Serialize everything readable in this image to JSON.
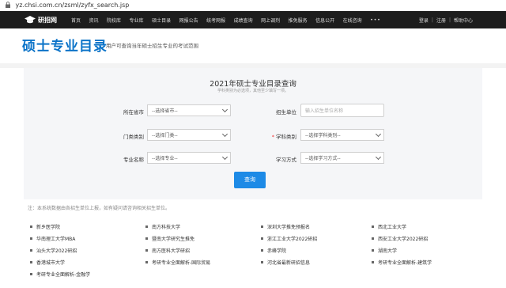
{
  "browser": {
    "url": "yz.chsi.com.cn/zsml/zyfx_search.jsp"
  },
  "nav": {
    "logo": "研招网",
    "items": [
      "首页",
      "资讯",
      "院校库",
      "专业库",
      "硕士目录",
      "网报公告",
      "统考网报",
      "成绩查询",
      "网上调剂",
      "推免服务",
      "信息公开",
      "在线咨询"
    ],
    "more": "•••",
    "login": "登录",
    "register": "注册",
    "help": "帮助中心",
    "sep": "|"
  },
  "header": {
    "title": "硕士专业目录",
    "subtitle": "用户可查询当年硕士招生专业的考试范围"
  },
  "form": {
    "title": "2021年硕士专业目录查询",
    "note": "学科类别为必选项，其他至少填写一项。",
    "province_label": "所在省市",
    "province_value": "--选择省市--",
    "unit_label": "招生单位",
    "unit_placeholder": "输入招生单位名称",
    "category_label": "门类类别",
    "category_value": "--选择门类--",
    "discipline_label": "学科类别",
    "discipline_value": "--选择学科类别--",
    "major_label": "专业名称",
    "major_value": "--选择专业--",
    "mode_label": "学习方式",
    "mode_value": "--选择学习方式--",
    "required_mark": "*",
    "submit": "查询"
  },
  "notice": "注：本系统数据由各招生单位上报，如有疑问请咨询相关招生单位。",
  "links": [
    [
      "新乡医学院",
      "南方科技大学",
      "深圳大学推免预报名",
      "西北工业大学"
    ],
    [
      "华南理工大学MBA",
      "暨南大学研究生推免",
      "浙江工业大学2022研招",
      "西安工业大学2022研招"
    ],
    [
      "汕头大学2022研招",
      "南方医科大学研招",
      "赤峰学院",
      "湖南大学"
    ],
    [
      "香港城市大学",
      "考研专业全面解析-国际贸易",
      "河北省最新研招信息",
      "考研专业全面解析-建筑学"
    ],
    [
      "考研专业全面解析-金融学"
    ]
  ],
  "colors": {
    "brand": "#0b73c8",
    "nav_bg": "#1d1d1d",
    "button": "#1d8ae6"
  }
}
